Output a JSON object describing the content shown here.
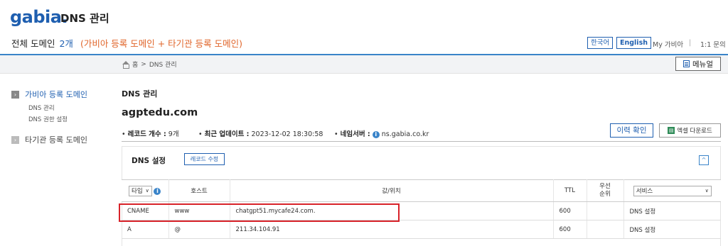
{
  "header": {
    "logo": "gabia.",
    "app_title": "DNS 관리",
    "domain_summary_label": "전체 도메인",
    "domain_count": "2개",
    "domain_detail": "(가비아 등록 도메인 + 타기관 등록 도메인)",
    "lang_ko": "한국어",
    "lang_en": "English",
    "my_gabia": "My 가비아",
    "separator": "|",
    "inquiry": "1:1 문의"
  },
  "breadcrumb": {
    "home": "홈",
    "sep": ">",
    "current": "DNS 관리"
  },
  "manual_button": "메뉴얼",
  "sidebar": {
    "active_section": "가비아 등록 도메인",
    "sub_items": [
      "DNS 관리",
      "DNS 권한 설정"
    ],
    "other_section": "타기관 등록 도메인"
  },
  "main": {
    "section_title": "DNS 관리",
    "domain": "agptedu.com",
    "record_count_label": "레코드 개수 :",
    "record_count": "9개",
    "last_update_label": "최근 업데이트 :",
    "last_update": "2023-12-02 18:30:58",
    "nameserver_label": "네임서버 :",
    "nameserver": "ns.gabia.co.kr",
    "history_button": "이력 확인",
    "excel_button": "엑셀 다운로드"
  },
  "dns_settings": {
    "title": "DNS 설정",
    "edit_button": "레코드 수정",
    "columns": {
      "type": "타입",
      "host": "호스트",
      "value": "값/위치",
      "ttl": "TTL",
      "priority_line1": "우선",
      "priority_line2": "순위",
      "service": "서비스"
    },
    "rows": [
      {
        "type": "CNAME",
        "host": "www",
        "value": "chatgpt51.mycafe24.com.",
        "ttl": "600",
        "priority": "",
        "service": "DNS 설정"
      },
      {
        "type": "A",
        "host": "@",
        "value": "211.34.104.91",
        "ttl": "600",
        "priority": "",
        "service": "DNS 설정"
      }
    ]
  },
  "colors": {
    "brand": "#1f5fb0",
    "accent_line": "#3a84c9",
    "orange": "#e0652a",
    "highlight": "#d8232a"
  },
  "icons": [
    "home-icon",
    "document-icon",
    "info-icon",
    "excel-icon",
    "chevron-up-icon",
    "chevron-down-icon",
    "arrow-right-icon"
  ]
}
